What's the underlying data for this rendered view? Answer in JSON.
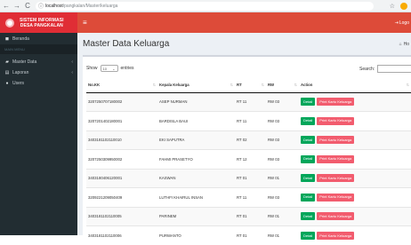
{
  "browser": {
    "url_host": "localhost",
    "url_path": "/pangkalan/Master/keluarga"
  },
  "sidebar": {
    "brand_line1": "SISTEM INFORMASI",
    "brand_line2": "DESA PANGKALAN",
    "items": [
      {
        "label": "Beranda",
        "icon": "dashboard-icon"
      },
      {
        "label": "MAIN MENU",
        "header": true
      },
      {
        "label": "Master Data",
        "icon": "folder-icon",
        "chevron": true
      },
      {
        "label": "Laporan",
        "icon": "report-icon",
        "chevron": true
      },
      {
        "label": "Users",
        "icon": "users-icon"
      }
    ]
  },
  "topbar": {
    "menu_icon": "hamburger-icon",
    "logout_label": "Logo"
  },
  "page": {
    "title": "Master Data Keluarga",
    "breadcrumb_home": "Ho"
  },
  "table_tools": {
    "show_label": "Show",
    "length_value": "10",
    "entries_label": "entries",
    "search_label": "Search:"
  },
  "table": {
    "columns": [
      "No.KK",
      "Kepala Keluarga",
      "RT",
      "RW",
      "Action"
    ],
    "detail_label": "Detail",
    "print_label": "Print Kartu Keluarga",
    "rows": [
      {
        "kk": "3207250707180002",
        "kepala": "ASEP NURMAN",
        "rt": "RT 11",
        "rw": "RW 03"
      },
      {
        "kk": "3207201402180001",
        "kepala": "BARDISLA BAUI",
        "rt": "RT 11",
        "rw": "RW 03"
      },
      {
        "kk": "3403181102110010",
        "kepala": "EKI SAPUTRA",
        "rt": "RT 02",
        "rw": "RW 03"
      },
      {
        "kk": "3207250309950002",
        "kepala": "FAHMI PRASETYO",
        "rt": "RT 12",
        "rw": "RW 03"
      },
      {
        "kk": "3403180406120001",
        "kepala": "KASWAN",
        "rt": "RT 01",
        "rw": "RW 01"
      },
      {
        "kk": "3209221209050409",
        "kepala": "LUTHFI KHAIRUL INSAN",
        "rt": "RT 11",
        "rw": "RW 03"
      },
      {
        "kk": "3403181102110005",
        "kepala": "PARINEM",
        "rt": "RT 01",
        "rw": "RW 01"
      },
      {
        "kk": "3403181102110006",
        "kepala": "PURWANTO",
        "rt": "RT 01",
        "rw": "RW 01"
      }
    ]
  },
  "colors": {
    "sidebar_bg": "#222d32",
    "brand_bg": "#e02d35",
    "topbar_bg": "#dd4b39",
    "detail_button": "#00a65a",
    "print_button": "#f25c6e"
  }
}
